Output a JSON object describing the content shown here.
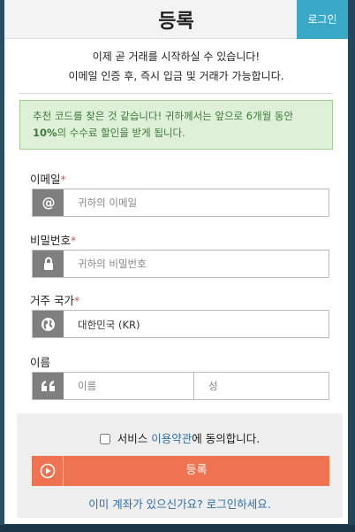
{
  "header": {
    "title": "등록",
    "login_label": "로그인"
  },
  "intro": {
    "line1": "이제 곧 거래를 시작하실 수 있습니다!",
    "line2": "이메일 인증 후, 즉시 입금 및 거래가 가능합니다."
  },
  "alert": {
    "text_before": "추천 코드를 찾은 것 같습니다! 귀하께서는 앞으로 6개월 동안 ",
    "highlight": "10%",
    "text_after": "의 수수료 할인을 받게 됩니다."
  },
  "form": {
    "email": {
      "label": "이메일",
      "required_mark": "*",
      "placeholder": "귀하의 이메일",
      "value": ""
    },
    "password": {
      "label": "비밀번호",
      "required_mark": "*",
      "placeholder": "귀하의 비밀번호",
      "value": ""
    },
    "country": {
      "label": "거주 국가",
      "required_mark": "*",
      "selected": "대한민국 (KR)"
    },
    "name": {
      "label": "이름",
      "first_placeholder": "이름",
      "last_placeholder": "성"
    }
  },
  "footer": {
    "agree_prefix": "서비스 ",
    "agree_link": "이용약관",
    "agree_suffix": "에 동의합니다.",
    "agree_checked": false,
    "register_label": "등록",
    "have_account": "이미 계좌가 있으신가요? 로그인하세요."
  },
  "icons": {
    "email": "at-icon",
    "password": "lock-icon",
    "country": "globe-icon",
    "name": "quote-icon",
    "register": "play-circle-icon"
  },
  "colors": {
    "accent": "#3aa9c7",
    "primary_button": "#ef7350",
    "alert_bg": "#dff0d8",
    "alert_text": "#3c7a3a",
    "link": "#2c6fa8",
    "required": "#d9534f"
  }
}
